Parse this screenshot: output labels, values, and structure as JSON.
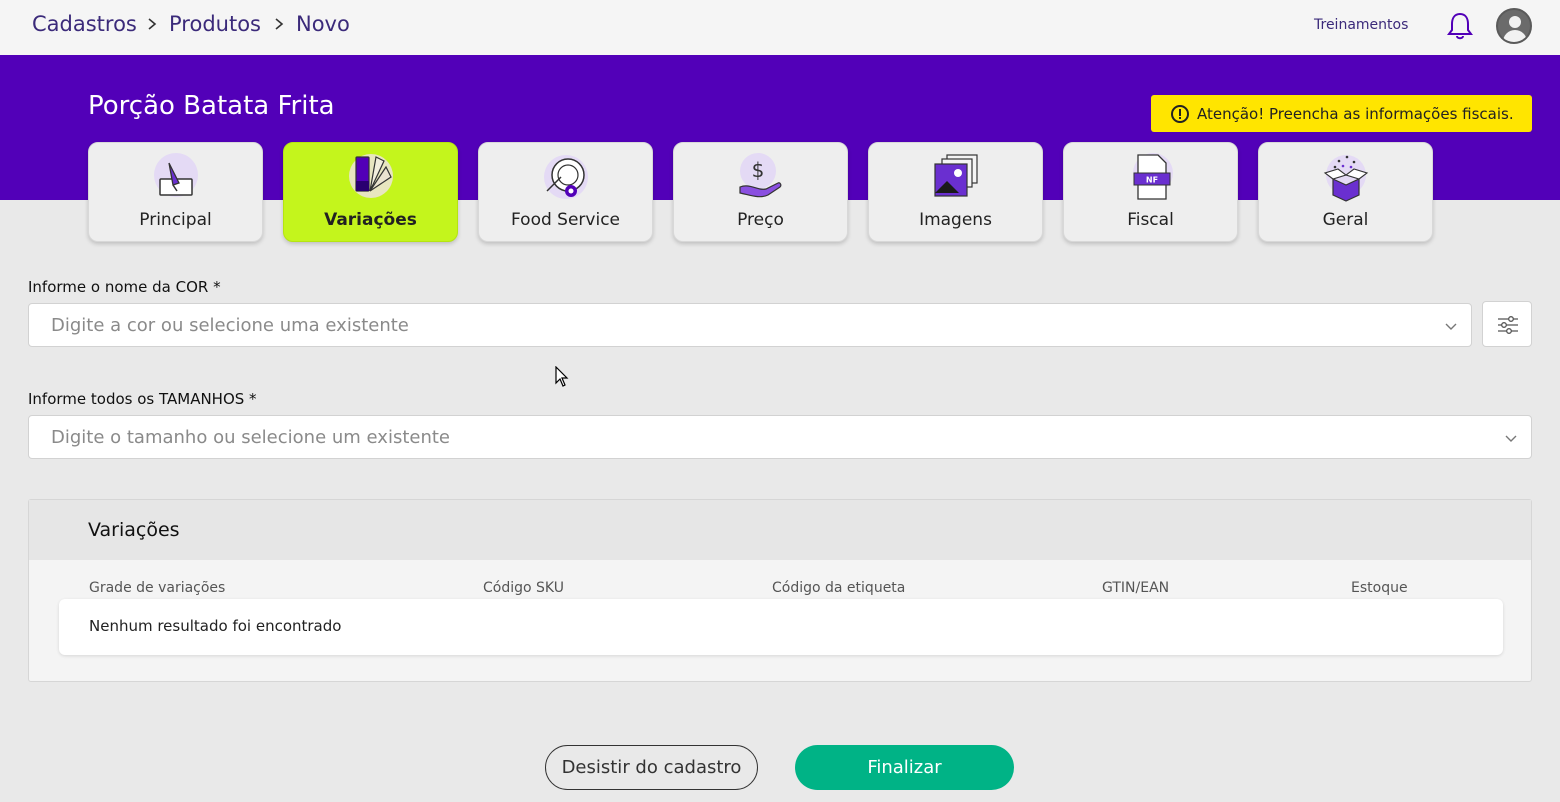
{
  "breadcrumb": {
    "items": [
      "Cadastros",
      "Produtos",
      "Novo"
    ]
  },
  "topbar": {
    "training_link": "Treinamentos"
  },
  "product": {
    "title": "Porção Batata Frita"
  },
  "alert": {
    "text": "Atenção! Preencha as informações fiscais."
  },
  "tabs": [
    {
      "label": "Principal",
      "icon": "edit-pencil-icon",
      "active": false
    },
    {
      "label": "Variações",
      "icon": "color-palette-icon",
      "active": true
    },
    {
      "label": "Food Service",
      "icon": "plate-cutlery-icon",
      "active": false
    },
    {
      "label": "Preço",
      "icon": "price-hand-icon",
      "active": false
    },
    {
      "label": "Imagens",
      "icon": "images-icon",
      "active": false
    },
    {
      "label": "Fiscal",
      "icon": "nf-document-icon",
      "active": false
    },
    {
      "label": "Geral",
      "icon": "open-box-icon",
      "active": false
    }
  ],
  "color_field": {
    "label": "Informe o nome da COR *",
    "placeholder": "Digite a cor ou selecione uma existente"
  },
  "size_field": {
    "label": "Informe todos os TAMANHOS *",
    "placeholder": "Digite o tamanho ou selecione um existente"
  },
  "variations": {
    "title": "Variações",
    "columns": [
      "Grade de variações",
      "Código SKU",
      "Código da etiqueta",
      "GTIN/EAN",
      "Estoque"
    ],
    "empty_message": "Nenhum resultado foi encontrado"
  },
  "actions": {
    "cancel": "Desistir do cadastro",
    "finish": "Finalizar"
  },
  "colors": {
    "brand_purple": "#5200b8",
    "active_tab": "#c4f51c",
    "alert_yellow": "#ffe500",
    "finish_green": "#00b386"
  }
}
